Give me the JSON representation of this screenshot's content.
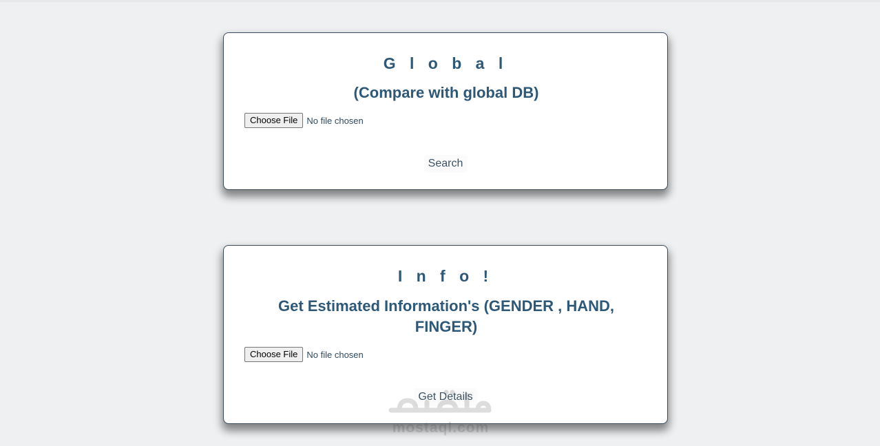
{
  "global_card": {
    "title": "G l o b a l",
    "subtitle": "(Compare with global DB)",
    "file_button": "Choose File",
    "file_status": "No file chosen",
    "action": "Search"
  },
  "info_card": {
    "title": "I n f o !",
    "subtitle": "Get Estimated Information's (GENDER , HAND, FINGER)",
    "file_button": "Choose File",
    "file_status": "No file chosen",
    "action": "Get Details"
  },
  "watermark": {
    "logo_text": "مستقل",
    "site": "mostaql.com"
  },
  "colors": {
    "background": "#eef0f2",
    "card": "#ffffff",
    "heading": "#2e5878",
    "border": "#3b4b5c"
  }
}
